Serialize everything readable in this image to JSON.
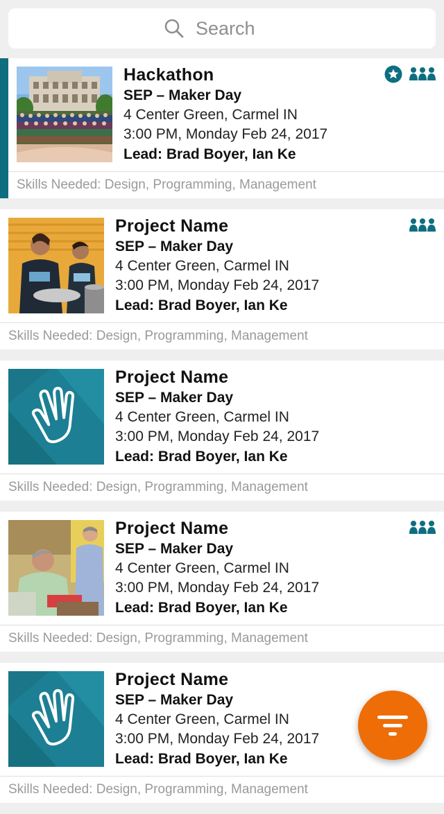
{
  "search": {
    "placeholder": "Search"
  },
  "cards": [
    {
      "title": "Hackathon",
      "event": "SEP – Maker Day",
      "address": "4 Center Green, Carmel IN",
      "datetime": "3:00 PM, Monday Feb 24, 2017",
      "lead": "Lead: Brad Boyer, Ian Ke",
      "skills": "Skills Needed: Design, Programming, Management",
      "image": "campus-group-photo",
      "starred": true,
      "team": true,
      "selected": true
    },
    {
      "title": "Project Name",
      "event": "SEP – Maker Day",
      "address": "4 Center Green, Carmel IN",
      "datetime": "3:00 PM, Monday Feb 24, 2017",
      "lead": "Lead: Brad Boyer, Ian Ke",
      "skills": "Skills Needed: Design, Programming, Management",
      "image": "volunteers-photo",
      "starred": false,
      "team": true,
      "selected": false
    },
    {
      "title": "Project Name",
      "event": "SEP – Maker Day",
      "address": "4 Center Green, Carmel IN",
      "datetime": "3:00 PM, Monday Feb 24, 2017",
      "lead": "Lead: Brad Boyer, Ian Ke",
      "skills": "Skills Needed: Design, Programming, Management",
      "image": "hand-logo",
      "starred": false,
      "team": false,
      "selected": false
    },
    {
      "title": "Project Name",
      "event": "SEP – Maker Day",
      "address": "4 Center Green, Carmel IN",
      "datetime": "3:00 PM, Monday Feb 24, 2017",
      "lead": "Lead: Brad Boyer, Ian Ke",
      "skills": "Skills Needed: Design, Programming, Management",
      "image": "workshop-photo",
      "starred": false,
      "team": true,
      "selected": false
    },
    {
      "title": "Project Name",
      "event": "SEP – Maker Day",
      "address": "4 Center Green, Carmel IN",
      "datetime": "3:00 PM, Monday Feb 24, 2017",
      "lead": "Lead: Brad Boyer, Ian Ke",
      "skills": "Skills Needed: Design, Programming, Management",
      "image": "hand-logo",
      "starred": false,
      "team": false,
      "selected": false
    }
  ],
  "fab": {
    "icon": "filter-icon"
  },
  "colors": {
    "accent": "#0e6e80",
    "fab": "#ee6d07",
    "teal_tile": "#1d7f93"
  }
}
